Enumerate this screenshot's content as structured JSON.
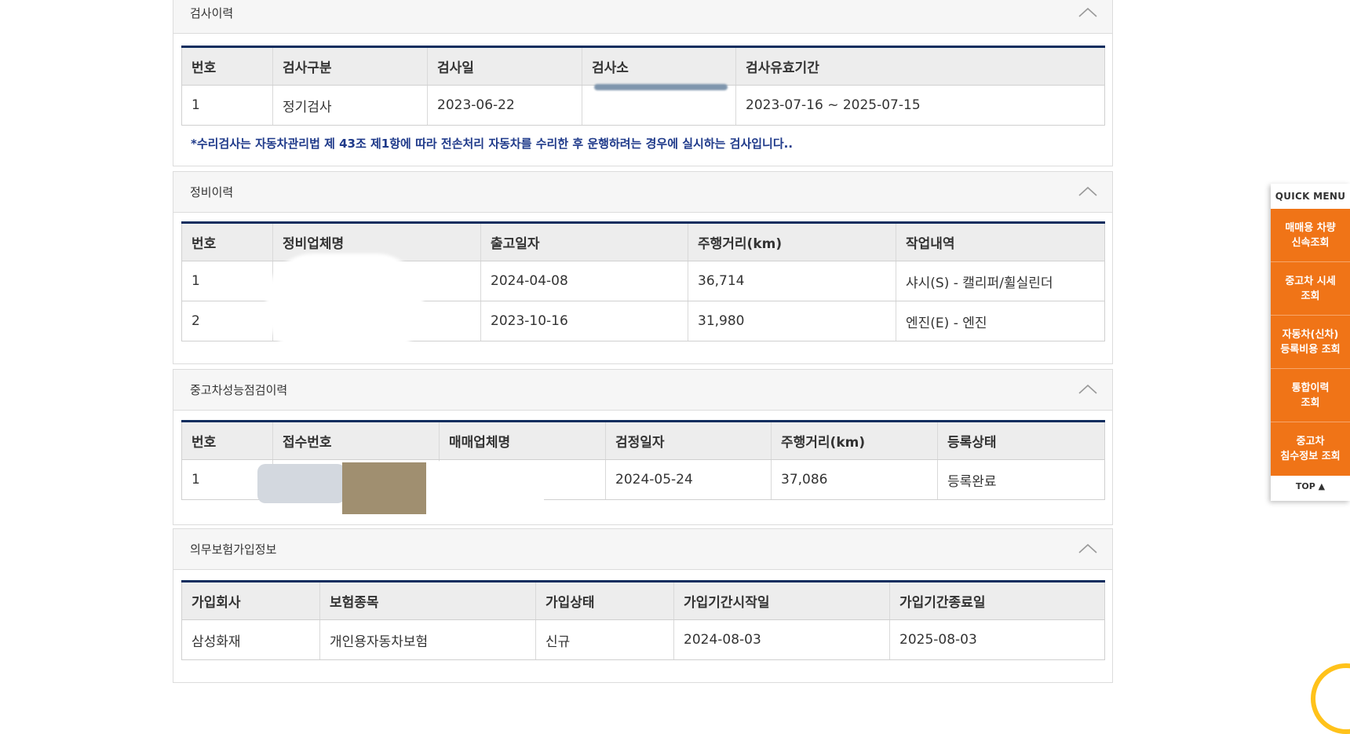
{
  "sections": {
    "inspection": {
      "title": "검사이력",
      "headers": [
        "번호",
        "검사구분",
        "검사일",
        "검사소",
        "검사유효기간"
      ],
      "rows": [
        [
          "1",
          "정기검사",
          "2023-06-22",
          "",
          "2023-07-16 ~ 2025-07-15"
        ]
      ],
      "note": "*수리검사는 자동차관리법 제 43조 제1항에 따라 전손처리 자동차를 수리한 후 운행하려는 경우에 실시하는 검사입니다.."
    },
    "maintenance": {
      "title": "정비이력",
      "headers": [
        "번호",
        "정비업체명",
        "출고일자",
        "주행거리(km)",
        "작업내역"
      ],
      "rows": [
        [
          "1",
          "",
          "2024-04-08",
          "36,714",
          "샤시(S) - 캘리퍼/휠실린더"
        ],
        [
          "2",
          "",
          "2023-10-16",
          "31,980",
          "엔진(E) - 엔진"
        ]
      ]
    },
    "performance": {
      "title": "중고차성능점검이력",
      "headers": [
        "번호",
        "접수번호",
        "매매업체명",
        "검정일자",
        "주행거리(km)",
        "등록상태"
      ],
      "rows": [
        [
          "1",
          "",
          "",
          "2024-05-24",
          "37,086",
          "등록완료"
        ]
      ]
    },
    "insurance": {
      "title": "의무보험가입정보",
      "headers": [
        "가입회사",
        "보험종목",
        "가입상태",
        "가입기간시작일",
        "가입기간종료일"
      ],
      "rows": [
        [
          "삼성화재",
          "개인용자동차보험",
          "신규",
          "2024-08-03",
          "2025-08-03"
        ]
      ]
    }
  },
  "quick_menu": {
    "title": "QUICK MENU",
    "items": [
      "매매용 차량\n신속조회",
      "중고차 시세\n조회",
      "자동차(신차)\n등록비용 조회",
      "통합이력\n조회",
      "중고차\n침수정보 조회"
    ],
    "top_label": "TOP ▲"
  },
  "colors": {
    "accent": "#f07417",
    "table_border": "#0d2d5e",
    "note": "#1f3a8a"
  }
}
